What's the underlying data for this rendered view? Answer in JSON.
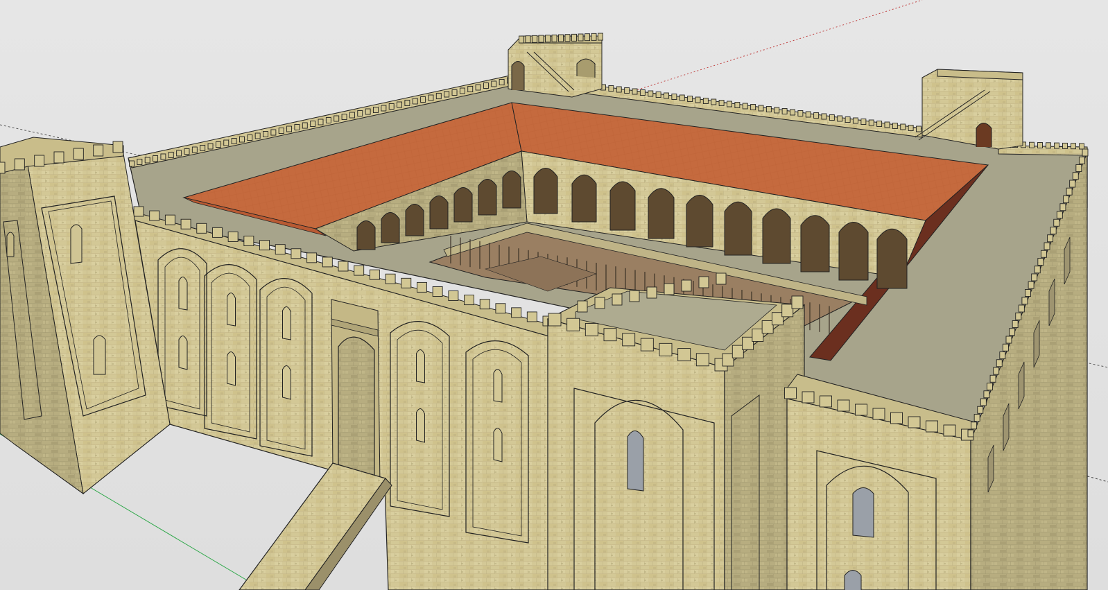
{
  "viewport": {
    "background": "#e3e3e3",
    "axis_colors": {
      "red": "#c04040",
      "green": "#2fa84a",
      "blue": "#4a4aa8"
    }
  },
  "model": {
    "subject": "castle-with-courtyard",
    "palette": {
      "stone_light": "#d8ce9c",
      "stone": "#c9bd8a",
      "stone_dark": "#9e9470",
      "walkway": "#a6a389",
      "roof": "#c1653b",
      "roof_dark": "#6b2f1f",
      "arch_shadow": "#5e4a30",
      "courtyard_floor": "#9a7f62",
      "edge": "#222222"
    }
  }
}
